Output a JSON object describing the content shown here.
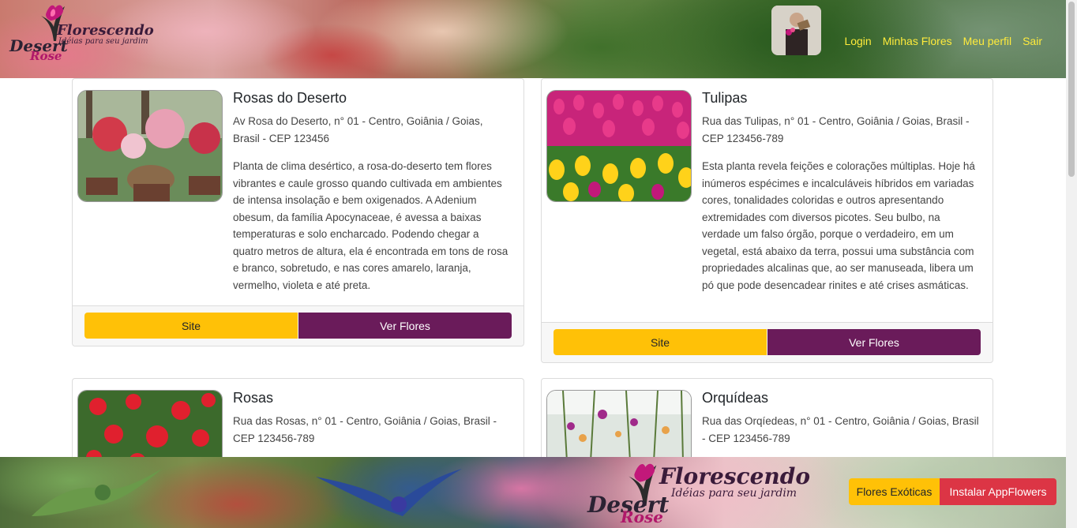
{
  "header": {
    "logo": {
      "brand_top": "Florescendo",
      "tagline": "Idéias para seu jardim",
      "brand_desert": "Desert",
      "brand_rose": "Rose"
    },
    "nav": [
      {
        "label": "Login"
      },
      {
        "label": "Minhas Flores"
      },
      {
        "label": "Meu perfil"
      },
      {
        "label": "Sair"
      }
    ]
  },
  "cards": [
    {
      "title": "Rosas do Deserto",
      "address": "Av Rosa do Deserto, n° 01 - Centro, Goiânia / Goias, Brasil - CEP 123456",
      "description": "Planta de clima desértico, a rosa-do-deserto tem flores vibrantes e caule grosso quando cultivada em ambientes de intensa insolação e bem oxigenados. A Adenium obesum, da família Apocynaceae, é avessa a baixas temperaturas e solo encharcado. Podendo chegar a quatro metros de altura, ela é encontrada em tons de rosa e branco, sobretudo, e nas cores amarelo, laranja, vermelho, violeta e até preta.",
      "site_label": "Site",
      "ver_label": "Ver Flores"
    },
    {
      "title": "Tulipas",
      "address": "Rua das Tulipas, n° 01 - Centro, Goiânia / Goias, Brasil - CEP 123456-789",
      "description": "Esta planta revela feições e colorações múltiplas. Hoje há inúmeros espécimes e incalculáveis híbridos em variadas cores, tonalidades coloridas e outros apresentando extremidades com diversos picotes. Seu bulbo, na verdade um falso órgão, porque o verdadeiro, em um vegetal, está abaixo da terra, possui uma substância com propriedades alcalinas que, ao ser manuseada, libera um pó que pode desencadear rinites e até crises asmáticas.",
      "site_label": "Site",
      "ver_label": "Ver Flores"
    },
    {
      "title": "Rosas",
      "address": "Rua das Rosas, n° 01 - Centro, Goiânia / Goias, Brasil - CEP 123456-789"
    },
    {
      "title": "Orquídeas",
      "address": "Rua das Orqíedeas, n° 01 - Centro, Goiânia / Goias, Brasil - CEP 123456-789"
    }
  ],
  "footer": {
    "logo": {
      "brand_top": "Florescendo",
      "tagline": "Idéias para seu jardim",
      "brand_desert": "Desert",
      "brand_rose": "Rose"
    },
    "exoticas_label": "Flores Exóticas",
    "install_label": "Instalar AppFlowers"
  },
  "colors": {
    "accent_yellow": "#ffc107",
    "accent_purple": "#6a1b5a",
    "accent_red": "#dc3545",
    "nav_text": "#ffeb3b"
  }
}
